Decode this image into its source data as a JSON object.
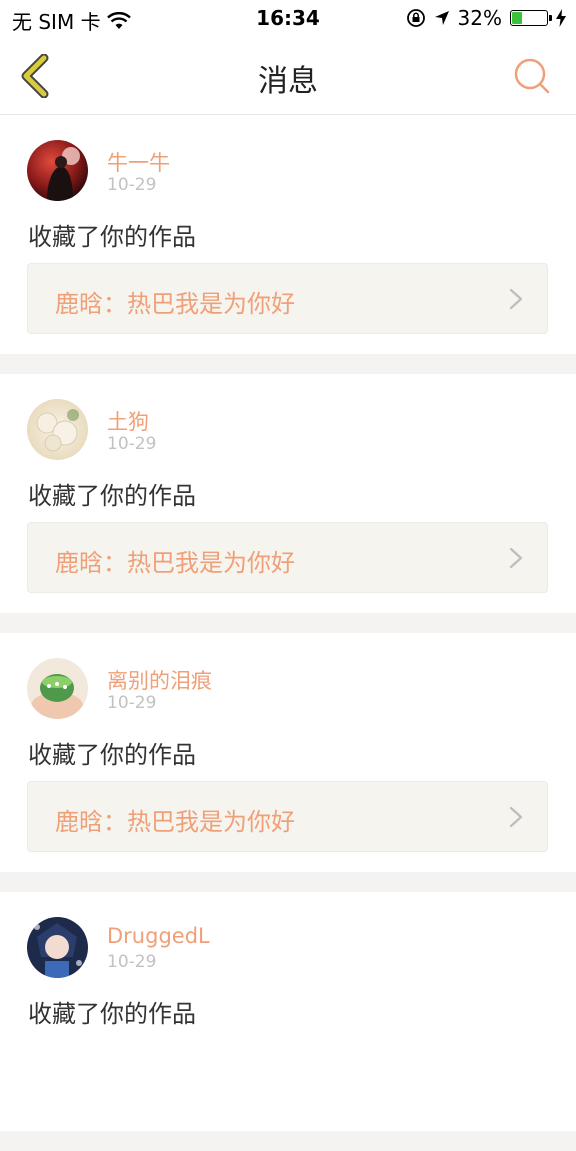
{
  "status_bar": {
    "carrier": "无 SIM 卡",
    "time": "16:34",
    "battery_percent": "32%",
    "battery_level": 0.32
  },
  "nav": {
    "title": "消息"
  },
  "messages": [
    {
      "username": "牛一牛",
      "date": "10-29",
      "action": "收藏了你的作品",
      "work": "鹿晗：热巴我是为你好"
    },
    {
      "username": "土狗",
      "date": "10-29",
      "action": "收藏了你的作品",
      "work": "鹿晗：热巴我是为你好"
    },
    {
      "username": "离别的泪痕",
      "date": "10-29",
      "action": "收藏了你的作品",
      "work": "鹿晗：热巴我是为你好"
    },
    {
      "username": "DruggedL",
      "date": "10-29",
      "action": "收藏了你的作品",
      "work": ""
    }
  ],
  "colors": {
    "accent": "#f0a078",
    "back_icon": "#d9cb3c",
    "battery": "#3cc13b"
  },
  "icons": [
    "back-icon",
    "search-icon",
    "wifi-icon",
    "lock-rotation-icon",
    "location-icon",
    "battery-icon",
    "charging-icon",
    "chevron-right-icon"
  ]
}
